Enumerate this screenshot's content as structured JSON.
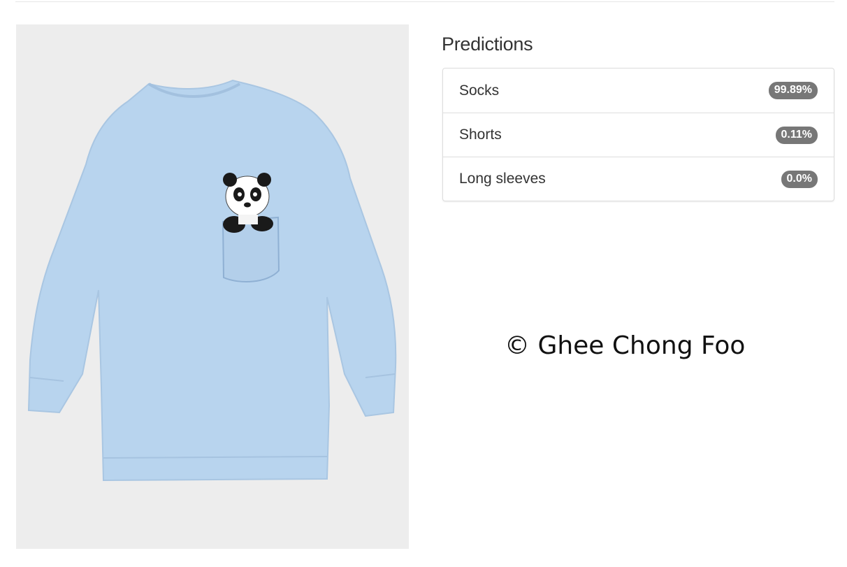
{
  "predictions": {
    "title": "Predictions",
    "items": [
      {
        "label": "Socks",
        "value": "99.89%"
      },
      {
        "label": "Shorts",
        "value": "0.11%"
      },
      {
        "label": "Long sleeves",
        "value": "0.0%"
      }
    ]
  },
  "watermark": {
    "text": "© Ghee Chong Foo"
  },
  "image": {
    "subject": "light blue long-sleeve shirt with panda pocket",
    "shirt_color": "#b8d4ee",
    "background_color": "#ededed"
  },
  "colors": {
    "badge": "#777777",
    "border": "#dddddd",
    "text": "#333333"
  }
}
